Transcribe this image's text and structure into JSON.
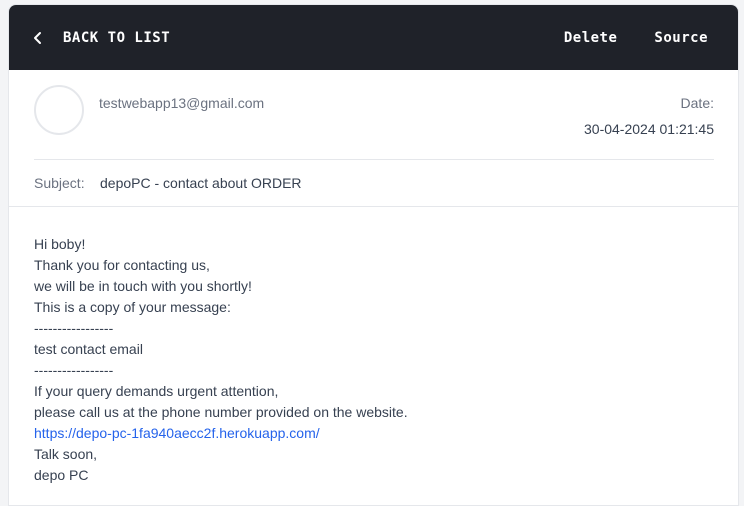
{
  "header": {
    "back_label": "BACK TO LIST",
    "delete_label": "Delete",
    "source_label": "Source"
  },
  "email": {
    "from": "testwebapp13@gmail.com",
    "date_label": "Date:",
    "date": "30-04-2024 01:21:45",
    "subject_label": "Subject:",
    "subject": "depoPC - contact about ORDER",
    "body_lines": [
      "Hi boby!",
      "Thank you for contacting us,",
      "we will be in touch with you shortly!",
      "This is a copy of your message:",
      "-----------------",
      "test contact email",
      "-----------------",
      "If your query demands urgent attention,",
      "please call us at the phone number provided on the website."
    ],
    "link": "https://depo-pc-1fa940aecc2f.herokuapp.com/",
    "closing_lines": [
      "Talk soon,",
      "depo PC"
    ]
  },
  "colors": {
    "topbar": "#1f2229",
    "link": "#2563eb"
  }
}
